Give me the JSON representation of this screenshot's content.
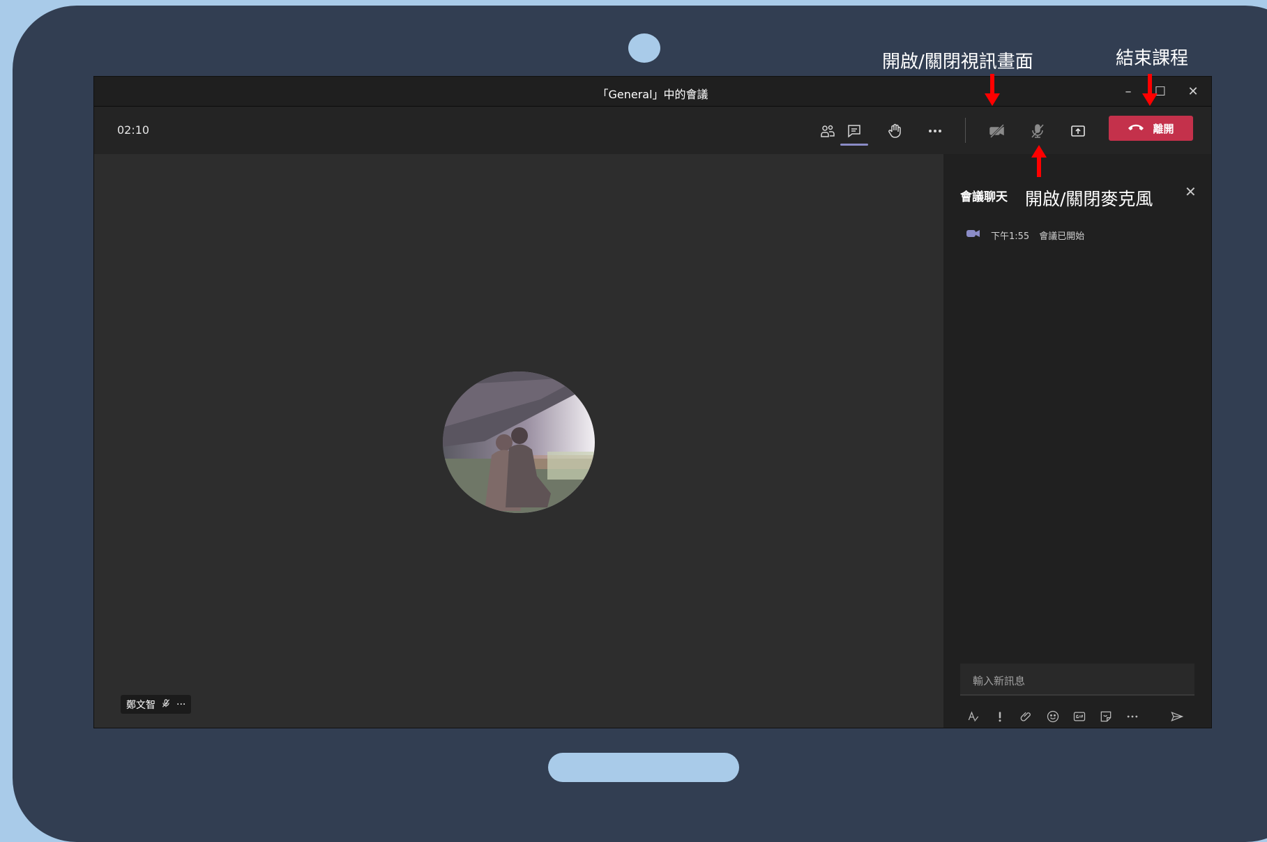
{
  "window": {
    "title": "「General」中的會議",
    "controls": [
      "minimize",
      "maximize",
      "close"
    ]
  },
  "toolbar": {
    "timer": "02:10",
    "icons": [
      "people-icon",
      "chat-icon",
      "raise-hand-icon",
      "more-icon",
      "camera-off-icon",
      "mic-off-icon",
      "share-screen-icon"
    ],
    "leave_label": "離開"
  },
  "stage": {
    "participant_name": "鄭文智",
    "more_label": "···"
  },
  "chat": {
    "title": "會議聊天",
    "system_message": {
      "time": "下午1:55",
      "text": "會議已開始"
    },
    "compose_placeholder": "輸入新訊息",
    "tools": [
      "format-icon",
      "important-icon",
      "attach-icon",
      "emoji-icon",
      "gif-icon",
      "sticker-icon",
      "more-icon",
      "send-icon"
    ]
  },
  "annotations": {
    "video_toggle": "開啟/關閉視訊畫面",
    "end_class": "結束課程",
    "mic_toggle": "開啟/關閉麥克風"
  },
  "colors": {
    "leave_red": "#c4314b",
    "accent_purple": "#8b8cc7",
    "arrow_red": "#ff0000",
    "tablet_frame": "#323e52",
    "background": "#a9cbe9"
  }
}
